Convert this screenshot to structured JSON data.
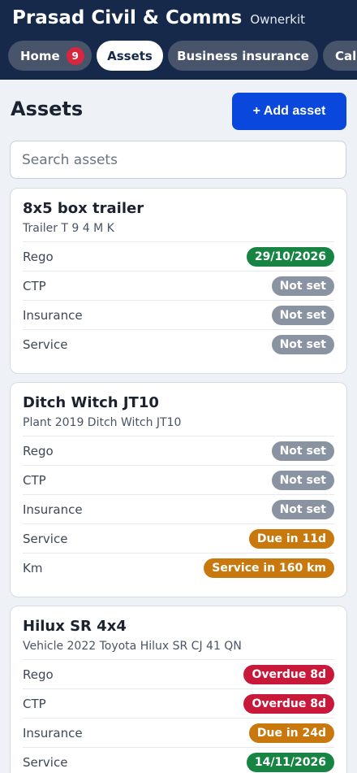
{
  "header": {
    "title": "Prasad Civil & Comms",
    "subtitle": "Ownerkit"
  },
  "tabs": [
    {
      "label": "Home",
      "count": "9"
    },
    {
      "label": "Assets"
    },
    {
      "label": "Business insurance"
    },
    {
      "label": "Cal"
    }
  ],
  "page": {
    "title": "Assets",
    "add_label": "+ Add asset"
  },
  "search": {
    "placeholder": "Search assets",
    "value": ""
  },
  "assets": [
    {
      "name": "8x5 box trailer",
      "subtitle": "Trailer T 9 4 M K",
      "rows": [
        {
          "label": "Rego",
          "status": "29/10/2026",
          "tone": "green"
        },
        {
          "label": "CTP",
          "status": "Not set",
          "tone": "gray"
        },
        {
          "label": "Insurance",
          "status": "Not set",
          "tone": "gray"
        },
        {
          "label": "Service",
          "status": "Not set",
          "tone": "gray"
        }
      ]
    },
    {
      "name": "Ditch Witch JT10",
      "subtitle": "Plant 2019 Ditch Witch JT10",
      "rows": [
        {
          "label": "Rego",
          "status": "Not set",
          "tone": "gray"
        },
        {
          "label": "CTP",
          "status": "Not set",
          "tone": "gray"
        },
        {
          "label": "Insurance",
          "status": "Not set",
          "tone": "gray"
        },
        {
          "label": "Service",
          "status": "Due in 11d",
          "tone": "amber"
        },
        {
          "label": "Km",
          "status": "Service in 160 km",
          "tone": "amber"
        }
      ]
    },
    {
      "name": "Hilux SR 4x4",
      "subtitle": "Vehicle 2022 Toyota Hilux SR CJ 41 QN",
      "rows": [
        {
          "label": "Rego",
          "status": "Overdue 8d",
          "tone": "red"
        },
        {
          "label": "CTP",
          "status": "Overdue 8d",
          "tone": "red"
        },
        {
          "label": "Insurance",
          "status": "Due in 24d",
          "tone": "amber"
        },
        {
          "label": "Service",
          "status": "14/11/2026",
          "tone": "green"
        }
      ]
    }
  ],
  "colors": {
    "header_bg": "#16294a",
    "primary": "#0a47dc",
    "ok": "#178443",
    "unset": "#8a93a1",
    "due": "#c9780d",
    "overdue": "#c8193b"
  }
}
